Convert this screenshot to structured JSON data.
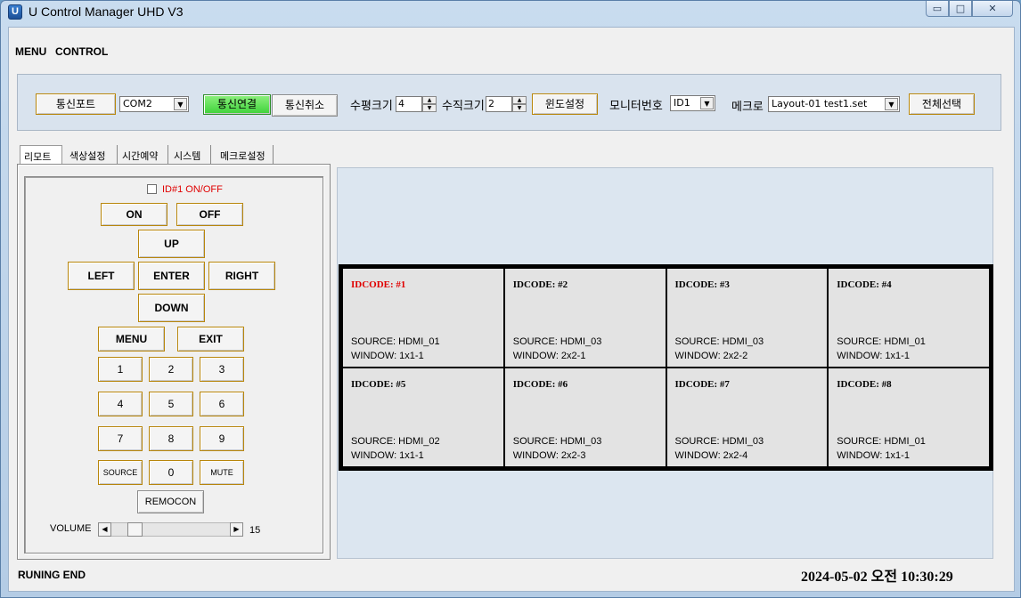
{
  "window": {
    "title": "U Control Manager UHD V3",
    "icon_letter": "U",
    "min_glyph": "▭",
    "max_glyph": "□",
    "close_glyph": "✕"
  },
  "menu": {
    "items": [
      "MENU",
      "CONTROL"
    ]
  },
  "toolbar": {
    "port_button": "통신포트",
    "port_select": "COM2",
    "connect_button": "통신연결",
    "disconnect_button": "통신취소",
    "h_size_label": "수평크기",
    "h_size_value": "4",
    "v_size_label": "수직크기",
    "v_size_value": "2",
    "window_setup_button": "윈도설정",
    "monitor_no_label": "모니터번호",
    "monitor_select": "ID1",
    "macro_label": "메크로",
    "macro_select": "Layout-01 test1.set",
    "select_all_button": "전체선택"
  },
  "tabs": [
    "리모트",
    "색상설정",
    "시간예약",
    "시스템",
    "메크로설정"
  ],
  "remote": {
    "id_toggle_label": "ID#1 ON/OFF",
    "on": "ON",
    "off": "OFF",
    "up": "UP",
    "left": "LEFT",
    "enter": "ENTER",
    "right": "RIGHT",
    "down": "DOWN",
    "menu": "MENU",
    "exit": "EXIT",
    "digits": [
      "1",
      "2",
      "3",
      "4",
      "5",
      "6",
      "7",
      "8",
      "9"
    ],
    "source": "SOURCE",
    "zero": "0",
    "mute": "MUTE",
    "remocon": "REMOCON",
    "volume_label": "VOLUME",
    "volume_value": "15"
  },
  "displays": [
    {
      "idcode": "IDCODE: #1",
      "source": "SOURCE:  HDMI_01",
      "window": "WINDOW: 1x1-1",
      "selected": true
    },
    {
      "idcode": "IDCODE: #2",
      "source": "SOURCE:  HDMI_03",
      "window": "WINDOW: 2x2-1",
      "selected": false
    },
    {
      "idcode": "IDCODE: #3",
      "source": "SOURCE:  HDMI_03",
      "window": "WINDOW: 2x2-2",
      "selected": false
    },
    {
      "idcode": "IDCODE: #4",
      "source": "SOURCE:  HDMI_01",
      "window": "WINDOW: 1x1-1",
      "selected": false
    },
    {
      "idcode": "IDCODE: #5",
      "source": "SOURCE:  HDMI_02",
      "window": "WINDOW: 1x1-1",
      "selected": false
    },
    {
      "idcode": "IDCODE: #6",
      "source": "SOURCE:  HDMI_03",
      "window": "WINDOW: 2x2-3",
      "selected": false
    },
    {
      "idcode": "IDCODE: #7",
      "source": "SOURCE:  HDMI_03",
      "window": "WINDOW: 2x2-4",
      "selected": false
    },
    {
      "idcode": "IDCODE: #8",
      "source": "SOURCE:  HDMI_01",
      "window": "WINDOW: 1x1-1",
      "selected": false
    }
  ],
  "status": {
    "left": "RUNING END",
    "datetime": "2024-05-02 오전 10:30:29"
  },
  "colors": {
    "selected_id": "#e00000",
    "connect_green": "#3ed33a",
    "button_border": "#b8860b"
  }
}
